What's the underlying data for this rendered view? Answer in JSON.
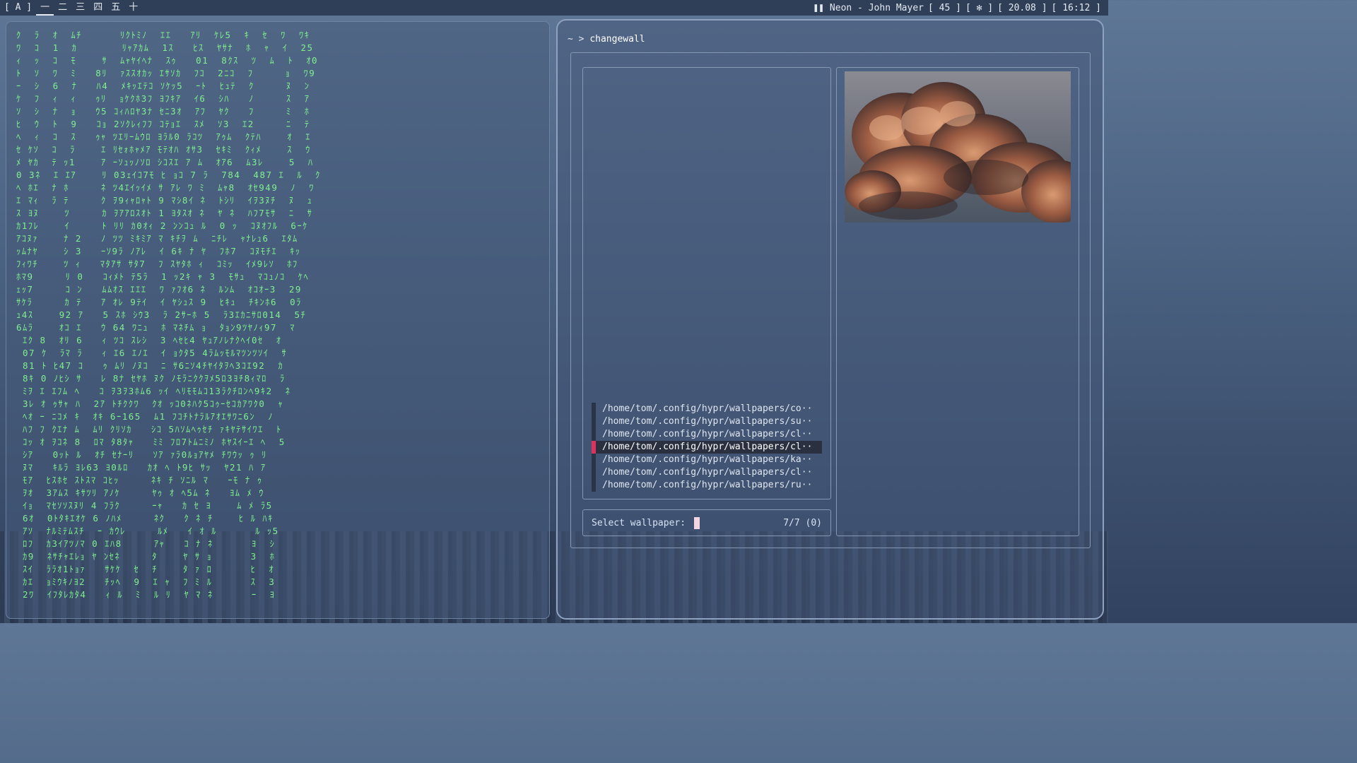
{
  "topbar": {
    "launcher": "[ A ]",
    "workspaces": [
      "一",
      "二",
      "三",
      "四",
      "五",
      "十"
    ],
    "active_workspace": 0,
    "media": "Neon - John Mayer",
    "volume": "[ 45 ]",
    "bluetooth": "[ ✻ ]",
    "battery": "[ 20.08 ]",
    "clock": "[ 16:12 ]"
  },
  "matrix": {
    "lines": [
      "ｸ  ﾗ  ｵ  ﾑﾁ      ﾘｸﾄﾐﾉ  ｴｴ   ｱﾘ  ｹﾚ5  ｷ  ｾ  ﾜ  ﾜｷ",
      "ﾜ  ｺ  1  ｶ       ﾘｬｱｶﾑ  1ｽ   ﾋｽ  ﾔｻﾅ  ﾎ  ｬ  ｲ  25",
      "ｨ  ｯ  ｺ  ﾓ    ｻ  ﾑｬﾔｲﾍﾅ  ｽｩ   01  8ｸｽ  ﾂ  ﾑ  ﾄ  ｵ0",
      "ﾄ  ｿ  ﾜ  ﾐ   8ﾘ  ｧｽｽｵｶｯ ｴｻｿｶ  ﾌｺ  2ﾆｺ  ﾌ     ｮ  ﾜ9",
      "ｰ  ｼ  6  ﾅ   ﾊ4  ﾒｷｯｴﾃｺ ｿｹｯ5  ｰﾄ  ﾋｭﾃ  ｸ     ﾇ  ﾝ",
      "ｹ  ﾌ  ｨ  ｨ   ｩﾘ  ｮｹｸﾎ3ﾌ ﾖﾌｷｱ  ｲ6  ｼﾊ   ﾉ     ｽ  ｱ",
      "ｿ  ｼ  ﾅ  ｮ   ｳ5 ｺｨﾊﾛﾔ3ﾅ ｾﾆ3ｵ  ｱﾌ  ﾔｸ   ﾌ     ﾐ  ﾎ",
      "ﾋ  ｳ  ﾄ  9   ｺｮ 2ｿｸﾚｨﾌﾌ ｺﾃｮｴ  ｽﾒ  ｿ3  ｴ2     ﾆ  ﾃ",
      "ﾍ  ｨ  ｺ  ｽ   ｩｬ ﾂｴﾘｰﾑｳﾛ ﾖﾗﾙ0 ﾗｺﾂ  ｱｩﾑ  ｸﾃﾊ    ｵ  ｴ",
      "ｾ ｹｿ  ｺ  ﾗ    ｴ ﾘｾｫﾎｬﾒｱ ﾓﾃｵﾊ ｵｻ3  ｾｷﾐ  ｸｨﾒ    ｽ  ｳ",
      "ﾒ ﾔｶ  ﾃ ｯ1    ｱ ｰｿｭｯﾉｿﾛ ｼｺｽｴ ｱ ﾑ  ｵｱ6  ﾑ3ﾚ    5  ﾊ",
      "0 3ﾈ  ｴ ｴｱ    ﾘ 03ｪｲｺ7ﾓ ﾋ ｮｺ 7 ﾗ  784  487 ｴ  ﾙ  ｸ",
      "ﾍ ﾎｴ  ﾅ ﾎ     ﾈ ﾂ4ｴｲｯｲﾒ ｻ ｱﾚ ﾜ ﾐ  ﾑｬ8  ｵｾ949  ﾉ  ﾜ",
      "ｴ ﾏｨ  ﾗ ﾃ     ｸ ｦ9ｨｬﾛｬﾄ 9 ﾏｼ8ｲ ﾈ  ﾄｼﾘ  ｲｦ3ﾇﾁ  ﾇ  ｭ",
      "ｽ ﾖﾇ    ﾂ     ｶ ｦｱｱﾛｽｵﾄ 1 ﾖﾀｽｵ ﾈ  ﾔ ﾈ  ﾊﾌ7ﾓｻ  ﾆ  ｻ",
      "ｶ1ﾌﾚ    ｲ     ﾄ ﾘﾘ ｶ0ｵｨ 2 ﾝﾝｺｭ ﾙ  0 ｯ  ｺﾇｵﾌﾙ  6ｰｹ",
      "ｱｺﾇｧ    ﾅ 2   ﾉ ﾂﾂ ﾐｷﾐｱ ﾏ ｷﾁｦ ﾑ  ﾆﾁﾚ  ｬﾅﾚｭ6  ｴﾀﾑ",
      "ｯﾑﾅﾔ    ｼ 3   ｰｿ9ﾗ ﾉｱﾚ  ｲ 6ｷ ﾅ ﾔ  ﾌﾎ7  ｺﾇﾓﾁｴ  ｷｯ",
      "ﾌｨﾜﾁ    ﾂ ｨ   ﾏﾀｱｻ ｻﾀ7  ﾌ ｽﾔﾀﾎ ｨ  ｺﾐｯ  ｲﾒ9ﾚｿ  ﾎﾌ",
      "ﾎﾏ9     ﾘ 0   ｺｨﾒﾄ ﾃ5ﾗ  1 ｯ2ｷ ｬ 3  ﾓｻｭ  ﾏｺｭﾉｺ  ｹﾍ",
      "ｪｯ7     ｺ ﾝ   ﾑﾑｵｽ ｴｴｴ  ﾜ ｧﾌｵ6 ﾈ  ﾙﾝﾑ  ｵｺｵｰ3  29",
      "ｻｹﾗ     ｶ ﾃ   ｱ ｵﾚ 9ﾃｲ  ｲ ﾔｼｭｽ 9  ﾋｷｭ  ﾁｷﾝﾎ6  0ﾗ",
      "ｭ4ｽ    92 ｱ   5 ｽﾎ ｼｳ3  ﾗ 2ｻｰﾎ 5  ﾗ3ｴｶﾆｻﾛ014  5ﾁ",
      "6ﾑﾗ    ｵｺ ｴ   ｳ 64 ﾜﾆｭ  ﾎ ﾏﾈﾁﾑ ｮ  ﾀｮﾝ9ﾂﾔﾉｨ97  ﾏ",
      " ｴｸ 8  ｵﾘ 6   ｨ ﾂｺ ｽﾚｼ  3 ﾍｾﾋ4 ﾔｭｱﾉﾚﾅｸﾍｲ0ｾ  ｵ",
      " 07 ｹ  ﾗﾏ ﾗ   ｨ ｴ6 ｴﾉｴ  ｲ ｮｸﾀ5 4ﾗﾑｯﾓﾙﾏﾂﾝﾂｿｲ  ｻ",
      " 81 ﾄ ﾋ47 ｺ   ｩ ﾑﾘ ﾉﾇｺ  ﾆ ｻ6ﾆｿ4ﾁﾔｲﾀｦﾍ3ｺｴ92  ｶ",
      " 8ｷ 0 ﾉﾋｼ ｻ   ﾚ 8ﾅ ｾﾔﾎ ﾇｸ ﾉﾓﾗﾆｸｸｦﾒ5ﾛ3ﾖﾁ8ｨﾏﾛ  ﾗ",
      " ﾐｦ ｴ ｴﾌﾑ ﾍ   ｺ ｦ3ｦ3ﾎﾑ6 ｯｲ ﾍﾘﾓﾓﾑｺ13ﾗｸﾁﾛﾝﾍ9ｷ2  ﾈ",
      " 3ﾚ ｵ ｩｻｬ ﾊ  2ｱ ﾄﾁｸｸﾜ  ｸｵ ｯｺ0ﾈﾊｸ5ｺｩｰｾｺｶｱﾜｸ0  ｬ",
      " ﾍｵ ｰ ﾆｺﾒ ｷ  ｵｷ 6ｰ165  ﾑ1 ﾌｺﾁﾄﾅﾗﾙｱｵｴｻﾜﾆ6ﾝ  ﾉ",
      " ﾊﾌ ﾌ ｸｴﾅ ﾑ  ﾑﾘ ｸﾘｿｶ   ｼｺ 5ﾊｿﾑﾍｩｾﾁ ｧｷﾔﾃｻｲﾜｴ  ﾄ",
      " ｺｯ ｵ ｦｺﾈ 8  ﾛﾏ ﾀ8ﾀｬ   ﾐﾐ ﾌﾛ7ﾄﾑﾆﾐﾉ ﾎﾔｽｲｰｴ ﾍ  5",
      " ｼｱ   0ｯﾄ ﾙ  ｵﾁ ｾﾅｰﾘ   ｿｱ ｧﾗ0ﾙｮｱﾔﾒ ﾁﾜｳｯ ｩ ﾘ",
      " ﾇﾏ   ｷﾙﾗ ﾖﾚ63 ﾖ0ﾙﾛ   ｶｵ ﾍ ﾄ9ﾋ ｻｯ  ﾔ21 ﾊ ｱ",
      " ﾓｱ  ﾋｽﾎｾ ｽﾄｽﾏ ｺﾋｯ     ﾈｷ ﾁ ｿﾆﾙ ﾏ   ｰﾓ ﾅ ｩ",
      " ｦｵ  3ｱﾑｽ ｷｻﾂﾘ ｱﾉｹ     ﾔｩ ｵ ﾍ5ﾑ ﾈ   ﾖﾑ ﾒ ｳ",
      " ｲｮ  ﾏｾｿｿｽﾇﾘ 4 ﾌﾗｸ     ｰｬ   ｶ ｾ ﾖ    ﾑ ﾒ ﾗ5",
      " 6ｵ  0ﾄﾀｷｴｵｹ 6 ﾉﾊﾒ     ﾈｸ   ｸ ﾈ ﾁ    ﾋ ﾙ ﾊｷ",
      " ｱｿ  ﾅﾙﾐﾃﾑｽﾁ  ｰ ｶｳﾚ     ﾙﾒ   ｲ ｵ ﾙ      ﾙ ｯ5",
      " ﾛﾌ  ｶ3ｲｱﾂﾉﾏ 0 ｴﾊ8     ｱｬ   ｺ ﾅ ﾈ      ﾖ  ｼ",
      " ｶ9  ﾈｻﾁｬｴﾚｮ ﾔ ﾝｾﾈ     ﾀ    ﾔ ｻ ｮ      3  ﾎ",
      " ｽｲ  ﾗﾗｵ1ﾄｮｧ   ｻｹｹ  ｾ  ﾁ    ﾀ ｧ ﾛ      ﾋ  ｵ",
      " ｶｴ  ｮﾐｳｷﾉﾖ2   ﾁｯﾍ  9  ｴ ｬ  ﾌ ﾐ ﾙ      ｽ  3",
      " 2ﾜ  ｲﾌﾀﾚｶﾀ4   ｨ ﾙ  ﾐ  ﾙ ﾘ  ﾔ ﾏ ﾈ      ｰ  ﾖ"
    ]
  },
  "terminal": {
    "prompt_symbol": "~ >",
    "command": "changewall",
    "picker": {
      "items": [
        "/home/tom/.config/hypr/wallpapers/co··",
        "/home/tom/.config/hypr/wallpapers/su··",
        "/home/tom/.config/hypr/wallpapers/cl··",
        "/home/tom/.config/hypr/wallpapers/cl··",
        "/home/tom/.config/hypr/wallpapers/ka··",
        "/home/tom/.config/hypr/wallpapers/cl··",
        "/home/tom/.config/hypr/wallpapers/ru··"
      ],
      "selected_index": 3,
      "input_label": "Select wallpaper:",
      "input_value": "",
      "match_count": "7/7 (0)"
    },
    "preview": {
      "image_subject": "sunset-clouds"
    }
  },
  "colors": {
    "matrix_text": "#7ff08e",
    "selection_marker": "#e0315a"
  }
}
